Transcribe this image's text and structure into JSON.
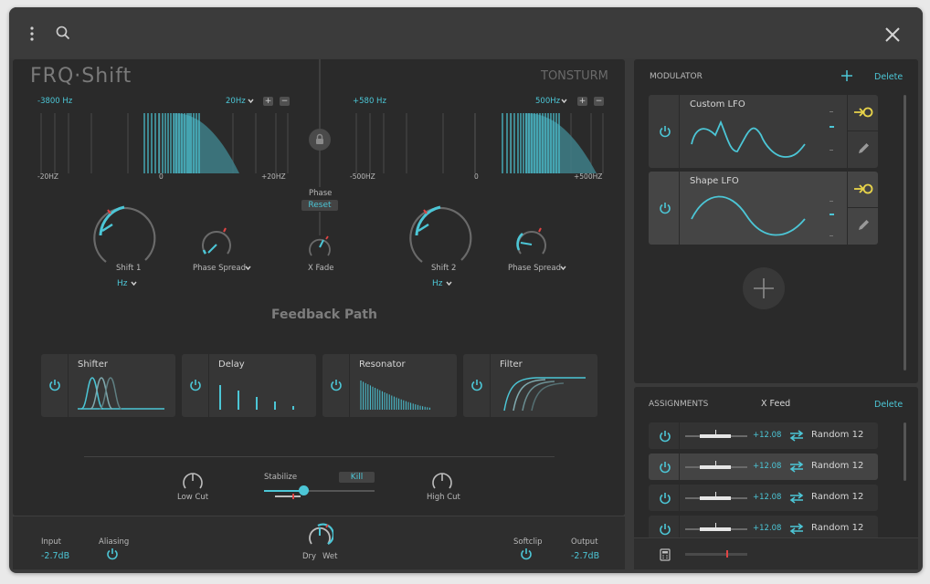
{
  "app": {
    "brand": "FRQ·Shift",
    "maker": "TONSTURM"
  },
  "toolbar": {
    "menu_icon": "kebab-menu-icon",
    "search_icon": "search-icon",
    "close_icon": "close-icon"
  },
  "shifter1": {
    "freq_readout": "-3800 Hz",
    "range": "20Hz",
    "axis": [
      "-20HZ",
      "0",
      "+20HZ"
    ],
    "knob_label": "Shift 1",
    "unit": "Hz",
    "spread_label": "Phase Spread"
  },
  "shifter2": {
    "freq_readout": "+580 Hz",
    "range": "500Hz",
    "axis": [
      "-500HZ",
      "0",
      "+500HZ"
    ],
    "knob_label": "Shift 2",
    "unit": "Hz",
    "spread_label": "Phase Spread"
  },
  "center": {
    "phase_label": "Phase",
    "reset_label": "Reset",
    "xfade_label": "X Fade"
  },
  "feedback_title": "Feedback Path",
  "fx": [
    {
      "name": "Shifter"
    },
    {
      "name": "Delay"
    },
    {
      "name": "Resonator"
    },
    {
      "name": "Filter"
    }
  ],
  "controls": {
    "low_cut": "Low Cut",
    "stabilize": "Stabilize",
    "kill": "Kill",
    "high_cut": "High Cut"
  },
  "footer": {
    "input_label": "Input",
    "input_value": "-2.7dB",
    "aliasing_label": "Aliasing",
    "dry_label": "Dry",
    "wet_label": "Wet",
    "softclip_label": "Softclip",
    "output_label": "Output",
    "output_value": "-2.7dB"
  },
  "modulator": {
    "title": "MODULATOR",
    "delete_label": "Delete",
    "items": [
      {
        "name": "Custom LFO"
      },
      {
        "name": "Shape LFO"
      }
    ]
  },
  "assignments": {
    "title": "ASSIGNMENTS",
    "source": "X Feed",
    "delete_label": "Delete",
    "rows": [
      {
        "amount": "+12.08",
        "target": "Random 12"
      },
      {
        "amount": "+12.08",
        "target": "Random 12"
      },
      {
        "amount": "+12.08",
        "target": "Random 12"
      },
      {
        "amount": "+12.08",
        "target": "Random 12"
      }
    ]
  },
  "colors": {
    "accent": "#4cc6d6",
    "indicator": "#e04444",
    "assign": "#e8d44a",
    "panel": "#2a2a2a"
  }
}
